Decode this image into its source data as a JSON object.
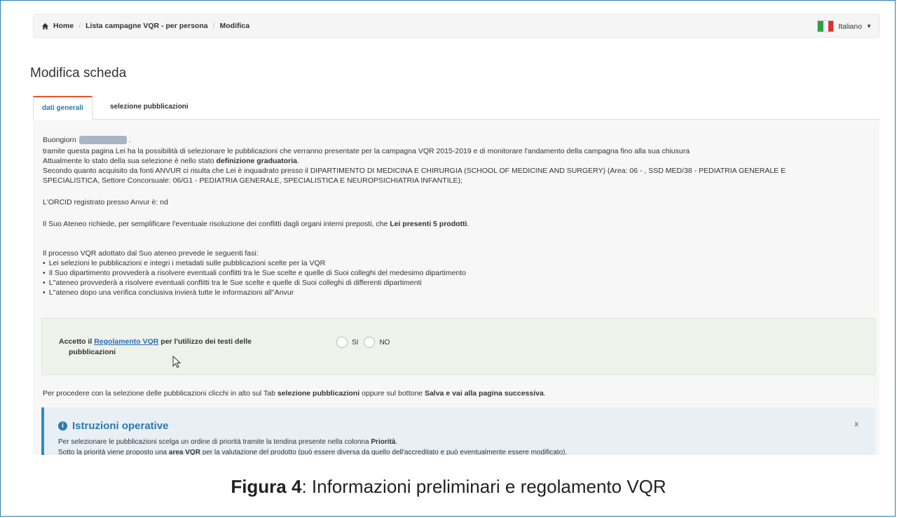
{
  "breadcrumb": {
    "home": "Home",
    "list": "Lista campagne VQR - per persona",
    "current": "Modifica"
  },
  "language": {
    "label": "Italiano",
    "flag_colors": [
      "#2e9e47",
      "#ffffff",
      "#d9342b"
    ]
  },
  "page_title": "Modifica scheda",
  "tabs": [
    {
      "label": "dati generali",
      "active": true
    },
    {
      "label": "selezione pubblicazioni",
      "active": false
    }
  ],
  "content": {
    "greeting": "Buongiorn",
    "greeting_end": ".",
    "line1": "tramite questa pagina Lei ha la possibilità di selezionare le pubblicazioni che verranno presentate per la campagna VQR 2015-2019 e di monitorare l'andamento della campagna fino alla sua chiusura",
    "line2_pre": "Attualmente lo stato della sua selezione è nello stato ",
    "line2_bold": "definizione graduatoria",
    "line2_post": ".",
    "line3": "Secondo quanto acquisito da fonti ANVUR ci risulta che Lei è inquadrato presso il DIPARTIMENTO DI MEDICINA E CHIRURGIA (SCHOOL OF MEDICINE AND SURGERY) (Area: 06 - , SSD MED/38 - PEDIATRIA GENERALE E",
    "line4": "SPECIALISTICA, Settore Concorsuale: 06/G1 - PEDIATRIA GENERALE, SPECIALISTICA E NEUROPSICHIATRIA INFANTILE);",
    "orcid": "L'ORCID registrato presso Anvur è: nd",
    "ateneo_pre": "Il Suo Ateneo richiede, per semplificare l'eventuale risoluzione dei conflitti dagli organi interni preposti, che ",
    "ateneo_bold": "Lei presenti 5 prodotti",
    "ateneo_post": ".",
    "process_intro": "Il processo VQR adottato dal Suo ateneo prevede le seguenti fasi:",
    "steps": [
      "Lei selezioni le pubblicazioni e integri i metadati sulle pubblicazioni scelte per la VQR",
      "Il Suo dipartimento provvederà a risolvere eventuali conflitti tra le Sue scelte e quelle di Suoi colleghi del medesimo dipartimento",
      "L''ateneo provvederà a risolvere eventuali conflitti tra le Sue scelte e quelle di Suoi colleghi di differenti dipartimenti",
      "L''ateneo dopo una verifica conclusiva invierà tutte le informazioni all''Anvur"
    ]
  },
  "accept": {
    "pre": "Accetto il ",
    "link": "Regolamento VQR",
    "post": " per l'utilizzo dei testi delle",
    "line2": "pubblicazioni",
    "yes": "SI",
    "no": "NO"
  },
  "proceed": {
    "pre": "Per procedere con la selezione delle pubblicazioni clicchi in alto sul Tab ",
    "bold1": "selezione pubblicazioni",
    "mid": " oppure sul bottone ",
    "bold2": "Salva e vai alla pagina successiva",
    "post": "."
  },
  "instructions": {
    "title": "Istruzioni operative",
    "close": "x",
    "line1_pre": "Per selezionare le pubblicazioni scelga un ordine di priorità tramite la tendina presente nella colonna ",
    "line1_bold": "Priorità",
    "line1_post": ".",
    "line2_pre": "Sotto la priorità viene proposto una ",
    "line2_bold": "area VQR",
    "line2_post": " per la valutazione del prodotto (può essere diversa da quello dell'accreditato e può eventualmente essere modificato)."
  },
  "caption": {
    "bold": "Figura 4",
    "rest": ": Informazioni preliminari e regolamento VQR"
  }
}
